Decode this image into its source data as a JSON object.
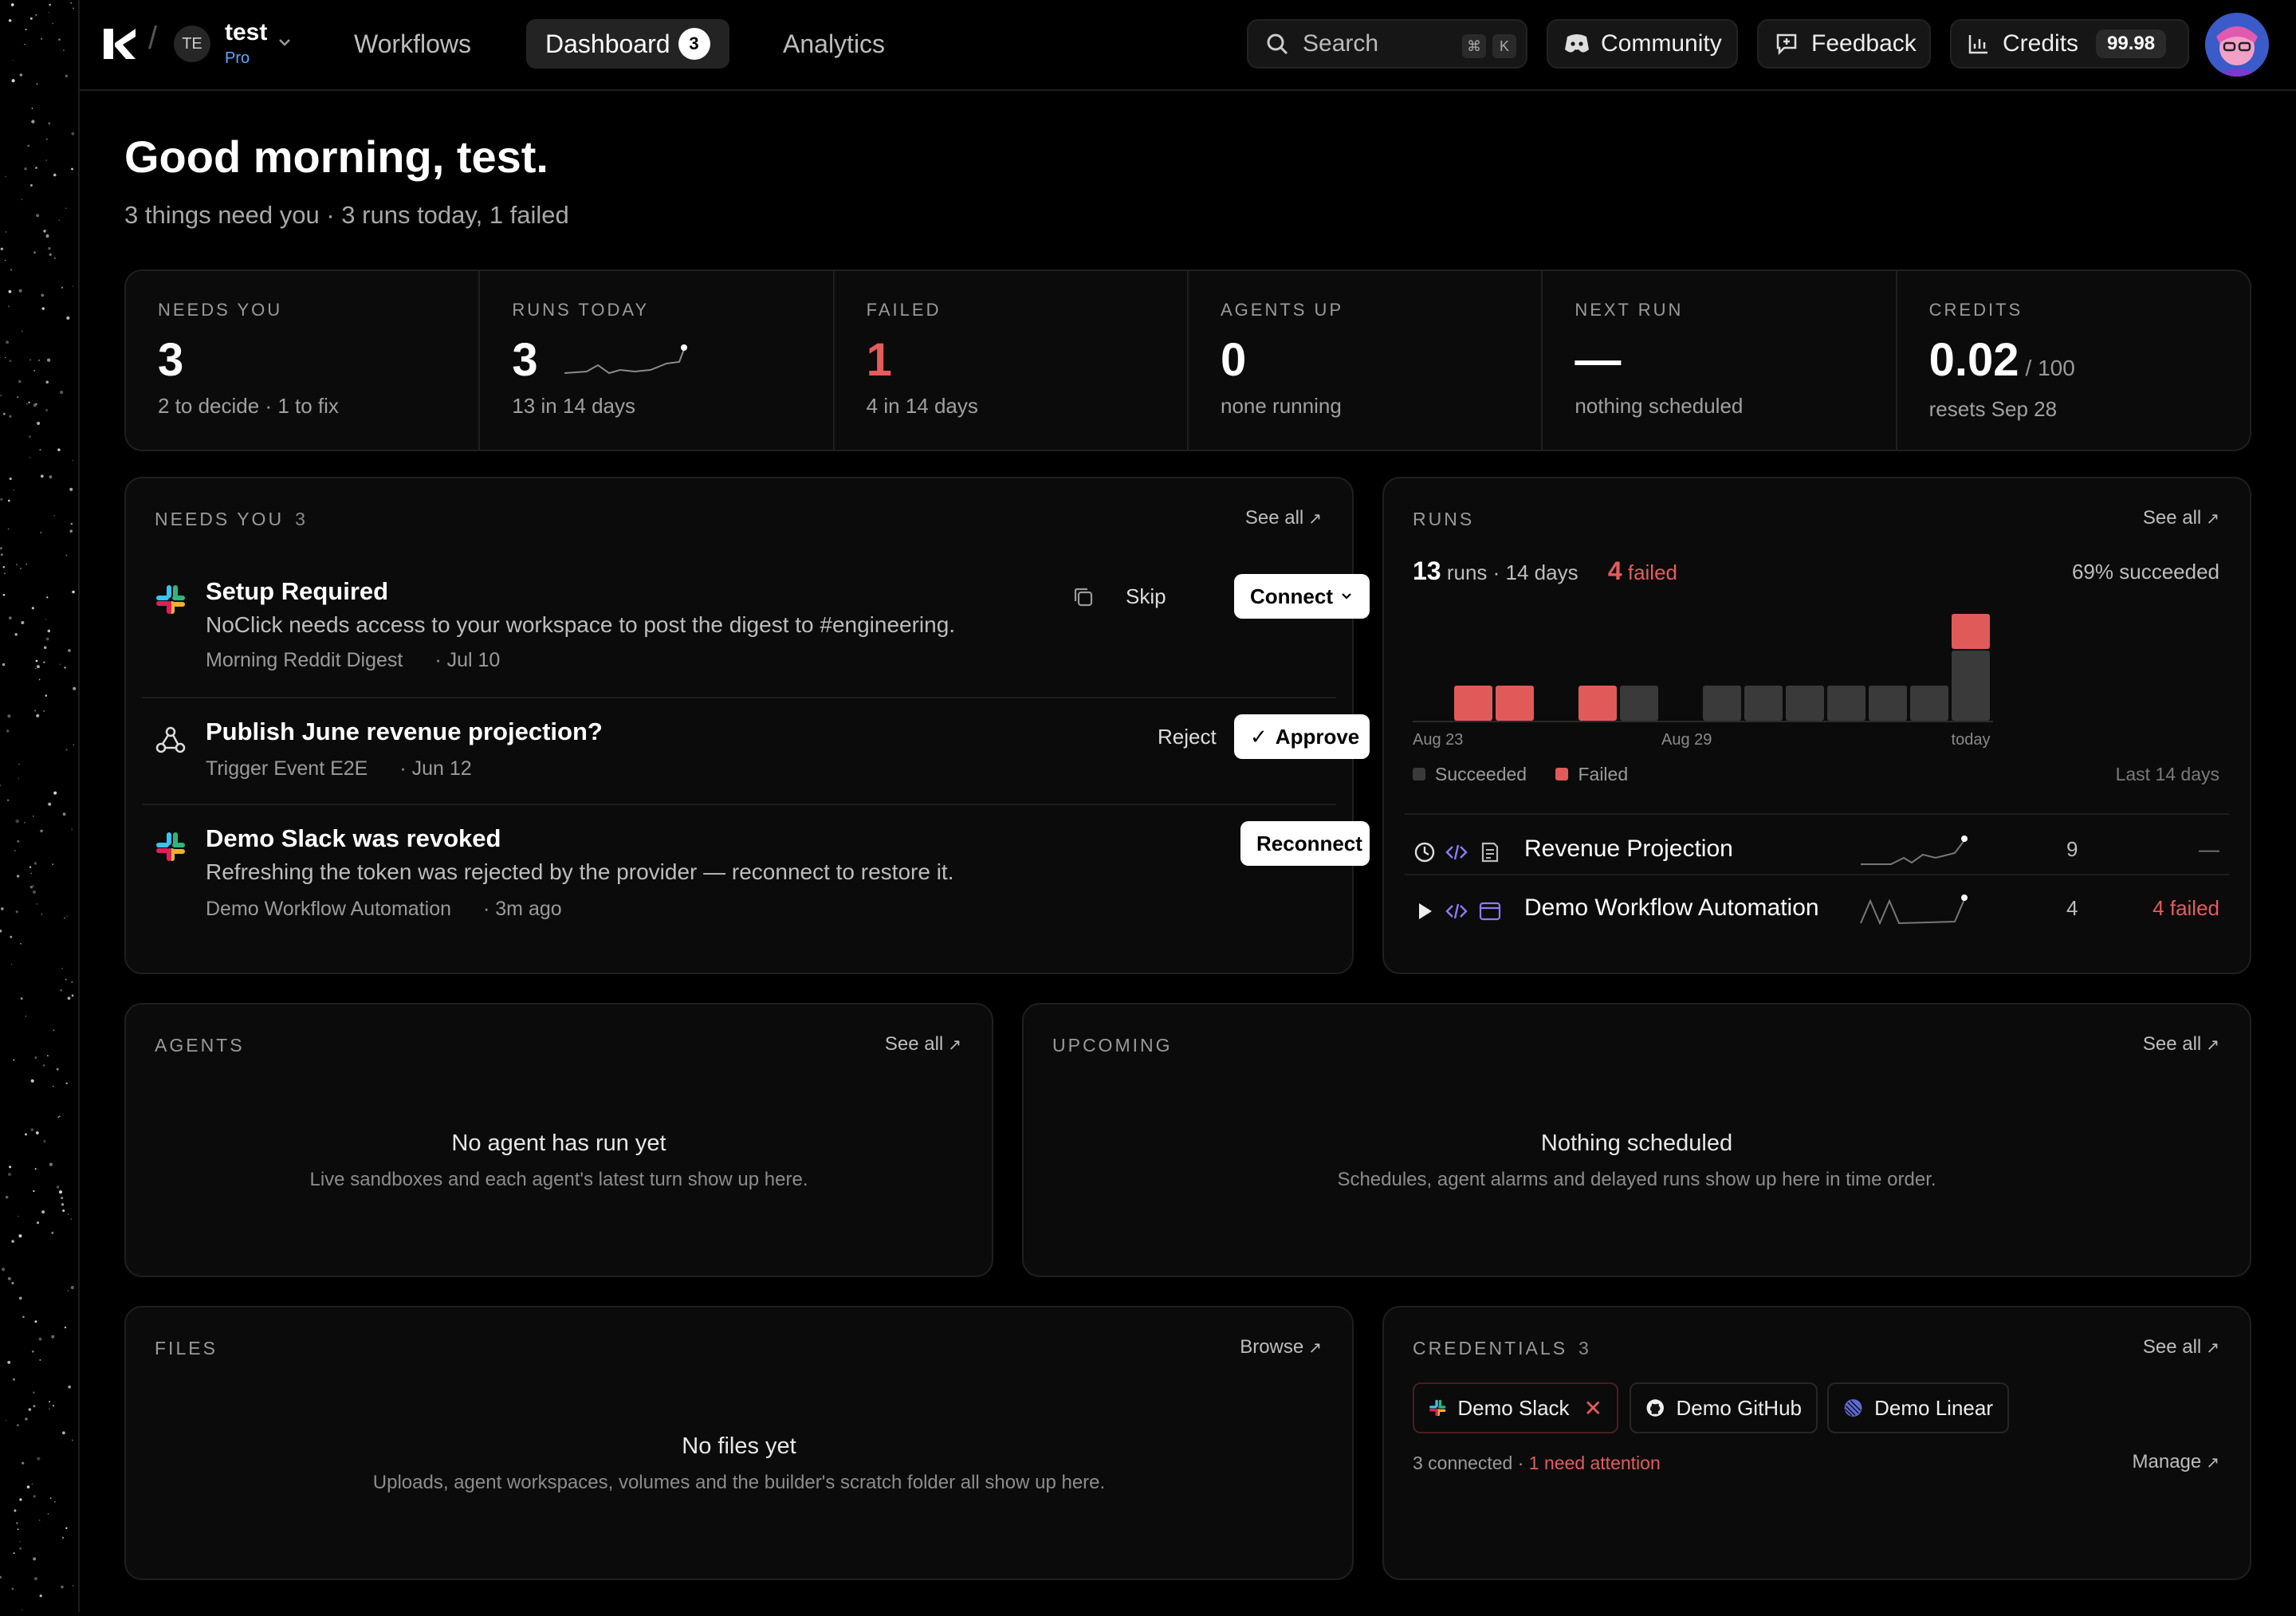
{
  "workspace": {
    "initials": "TE",
    "name": "test",
    "plan": "Pro"
  },
  "nav": {
    "workflows": "Workflows",
    "dashboard": "Dashboard",
    "dashboard_badge": "3",
    "analytics": "Analytics"
  },
  "topbar": {
    "search_label": "Search",
    "search_key1": "⌘",
    "search_key2": "K",
    "community": "Community",
    "feedback": "Feedback",
    "credits_label": "Credits",
    "credits_value": "99.98"
  },
  "greeting": {
    "title": "Good morning, test.",
    "subtitle": "3 things need you · 3 runs today, 1 failed"
  },
  "stats": [
    {
      "label": "NEEDS YOU",
      "value": "3",
      "note": "2 to decide · 1 to fix"
    },
    {
      "label": "RUNS TODAY",
      "value": "3",
      "note": "13 in 14 days"
    },
    {
      "label": "FAILED",
      "value": "1",
      "note": "4 in 14 days"
    },
    {
      "label": "AGENTS UP",
      "value": "0",
      "note": "none running"
    },
    {
      "label": "NEXT RUN",
      "value": "—",
      "note": "nothing scheduled"
    },
    {
      "label": "CREDITS",
      "value": "0.02",
      "unit": "/ 100",
      "note": "resets Sep 28"
    }
  ],
  "needs": {
    "title": "NEEDS YOU",
    "count": "3",
    "see_all": "See all",
    "items": [
      {
        "title": "Setup Required",
        "desc": "NoClick needs access to your workspace to post the digest to #engineering.",
        "source": "Morning Reddit Digest",
        "date": "· Jul 10",
        "secondary": "Skip",
        "primary": "Connect"
      },
      {
        "title": "Publish June revenue projection?",
        "source": "Trigger Event E2E",
        "date": "· Jun 12",
        "secondary": "Reject",
        "primary": "Approve"
      },
      {
        "title": "Demo Slack was revoked",
        "desc": "Refreshing the token was rejected by the provider — reconnect to restore it.",
        "source": "Demo Workflow Automation",
        "date": "· 3m ago",
        "primary": "Reconnect"
      }
    ]
  },
  "runs": {
    "title": "RUNS",
    "see_all": "See all",
    "total": "13",
    "total_suffix": "runs · 14 days",
    "failed": "4",
    "failed_suffix": "failed",
    "succeeded": "69% succeeded",
    "legend_succeeded": "Succeeded",
    "legend_failed": "Failed",
    "period": "Last 14 days",
    "workflows": [
      {
        "name": "Revenue Projection",
        "count": "9",
        "status": "—"
      },
      {
        "name": "Demo Workflow Automation",
        "count": "4",
        "status": "4 failed"
      }
    ]
  },
  "chart_data": {
    "type": "bar",
    "stacked": true,
    "categories": [
      "Aug 23",
      "Aug 24",
      "Aug 25",
      "Aug 26",
      "Aug 27",
      "Aug 28",
      "Aug 29",
      "Aug 30",
      "Aug 31",
      "Sep 1",
      "Sep 2",
      "Sep 3",
      "Sep 4",
      "today"
    ],
    "tick_labels": [
      "Aug 23",
      "Aug 29",
      "today"
    ],
    "series": [
      {
        "name": "Succeeded",
        "color": "#3a3a3a",
        "values": [
          0,
          0,
          0,
          0,
          0,
          1,
          0,
          1,
          1,
          1,
          1,
          1,
          1,
          2
        ]
      },
      {
        "name": "Failed",
        "color": "#e05a5a",
        "values": [
          0,
          1,
          1,
          0,
          1,
          0,
          0,
          0,
          0,
          0,
          0,
          0,
          0,
          1
        ]
      }
    ]
  },
  "agents": {
    "title": "AGENTS",
    "see_all": "See all",
    "empty_title": "No agent has run yet",
    "empty_desc": "Live sandboxes and each agent's latest turn show up here."
  },
  "upcoming": {
    "title": "UPCOMING",
    "see_all": "See all",
    "empty_title": "Nothing scheduled",
    "empty_desc": "Schedules, agent alarms and delayed runs show up here in time order."
  },
  "files": {
    "title": "FILES",
    "browse": "Browse",
    "empty_title": "No files yet",
    "empty_desc": "Uploads, agent workspaces, volumes and the builder's scratch folder all show up here."
  },
  "credentials": {
    "title": "CREDENTIALS",
    "count": "3",
    "see_all": "See all",
    "chips": [
      "Demo Slack",
      "Demo GitHub",
      "Demo Linear"
    ],
    "connected": "3 connected ·",
    "attention": "1 need attention",
    "manage": "Manage"
  },
  "colors": {
    "failed": "#e45c5c",
    "bar_succeeded": "#3a3a3a",
    "bar_failed": "#e05a5a",
    "plan": "#5aa8ff"
  }
}
